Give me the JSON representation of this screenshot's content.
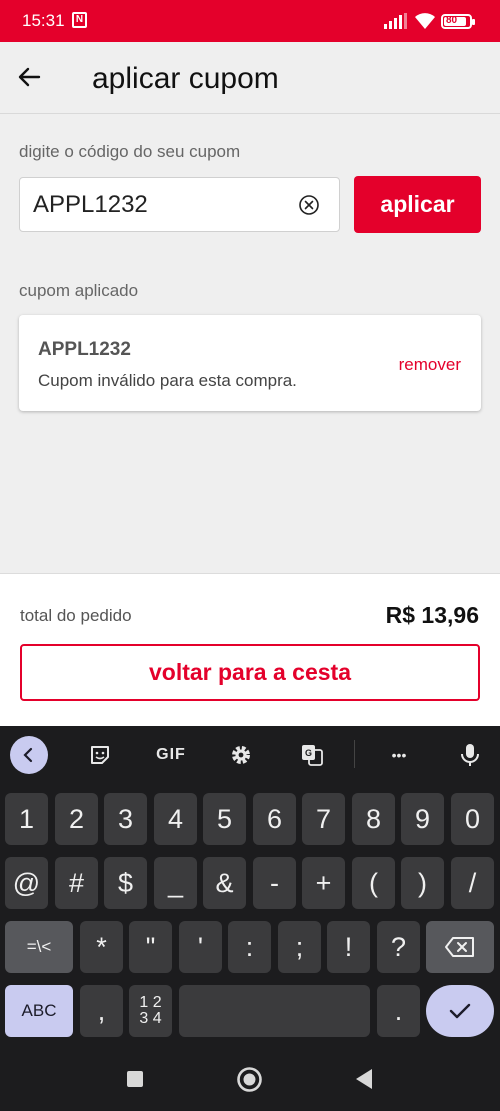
{
  "status": {
    "time": "15:31",
    "nfc": "N",
    "battery": "80"
  },
  "header": {
    "title": "aplicar cupom"
  },
  "coupon_entry": {
    "label": "digite o código do seu cupom",
    "value": "APPL1232",
    "apply_label": "aplicar"
  },
  "applied": {
    "label": "cupom aplicado",
    "code": "APPL1232",
    "message": "Cupom inválido para esta compra.",
    "remove_label": "remover"
  },
  "footer": {
    "total_label": "total do pedido",
    "total_value": "R$ 13,96",
    "back_label": "voltar para a cesta"
  },
  "keyboard": {
    "toolbar": {
      "gif": "GIF",
      "more": "•••"
    },
    "row1": [
      "1",
      "2",
      "3",
      "4",
      "5",
      "6",
      "7",
      "8",
      "9",
      "0"
    ],
    "row2": [
      "@",
      "#",
      "$",
      "_",
      "&",
      "-",
      "+",
      "(",
      ")",
      "/"
    ],
    "row3": {
      "shift": "=\\<",
      "keys": [
        "*",
        "\"",
        "'",
        ":",
        ";",
        "!",
        "?"
      ]
    },
    "row4": {
      "abc": "ABC",
      "comma": ",",
      "numpad_top": "1 2",
      "numpad_bottom": "3 4",
      "period": "."
    }
  },
  "colors": {
    "brand": "#e4002b",
    "accent_key": "#c9cbf0"
  }
}
